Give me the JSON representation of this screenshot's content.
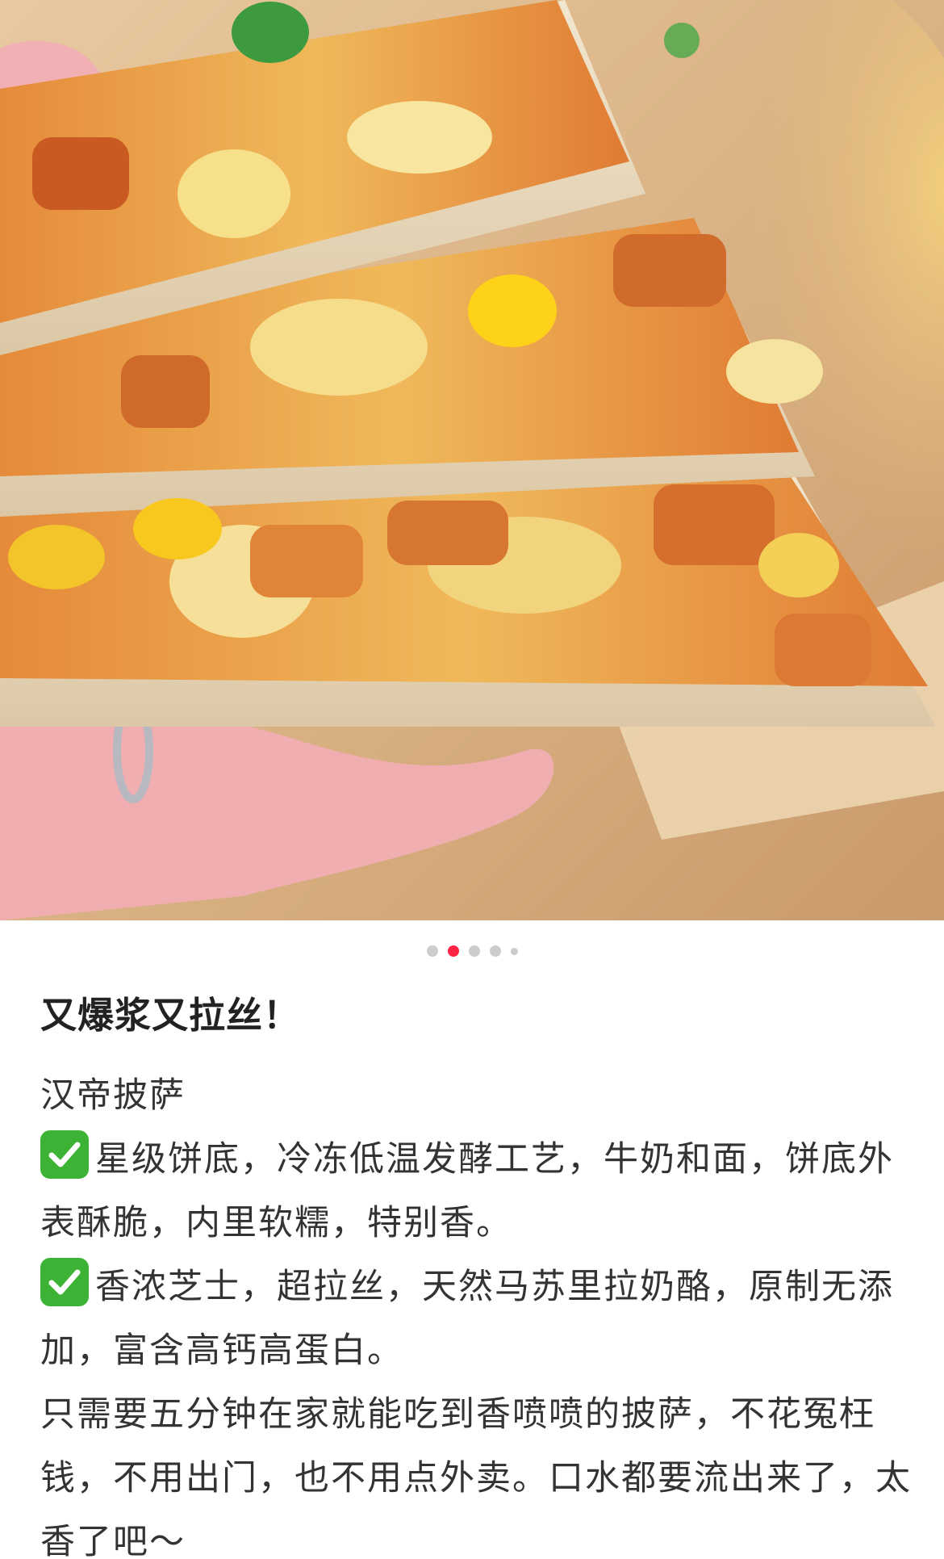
{
  "photo": {
    "subject": "pizza slices held in hand"
  },
  "carousel": {
    "total": 5,
    "active_index": 1,
    "colors": {
      "active": "#ff2442",
      "inactive": "#cccccc"
    }
  },
  "note": {
    "title": "又爆浆又拉丝！",
    "product": "汉帝披萨",
    "point_1": "星级饼底，冷冻低温发酵工艺，牛奶和面，饼底外表酥脆，内里软糯，特别香。",
    "point_2": "香浓芝士，超拉丝，天然马苏里拉奶酪，原制无添加，富含高钙高蛋白。",
    "closing": "只需要五分钟在家就能吃到香喷喷的披萨，不花冤枉钱，不用出门，也不用点外卖。口水都要流出来了，太香了吧～",
    "check_icon": "check-mark-button-emoji",
    "check_color": "#3cb335"
  }
}
